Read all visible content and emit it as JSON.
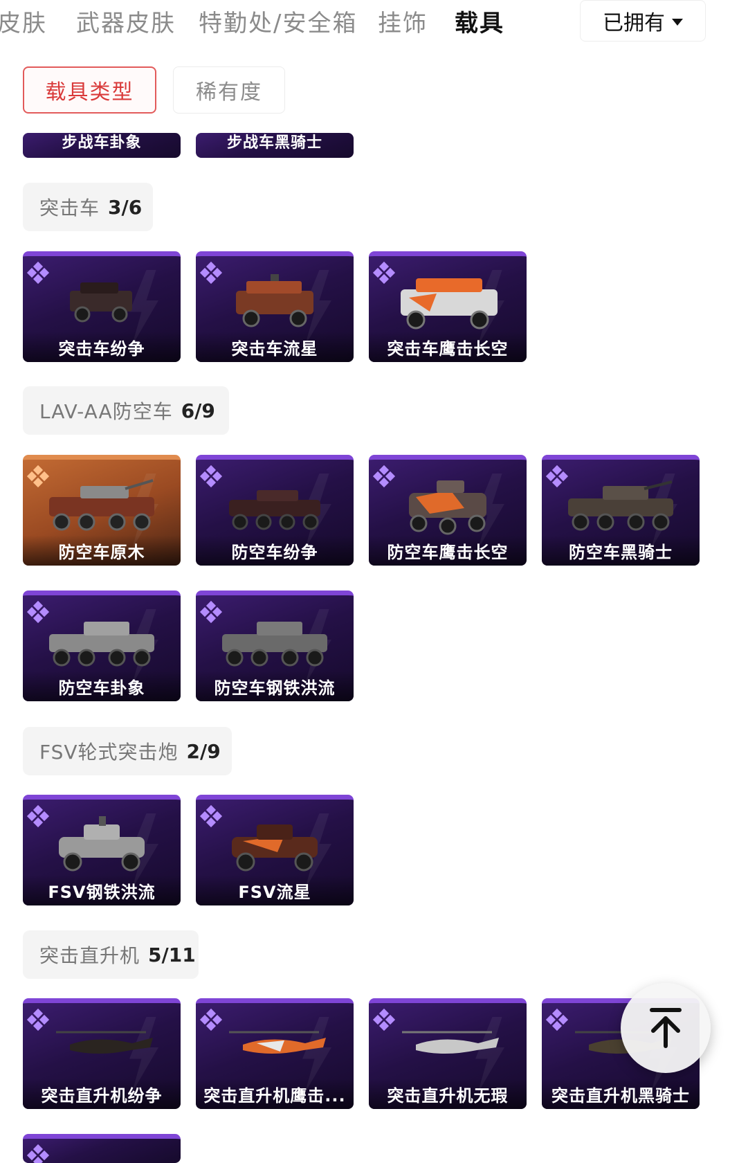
{
  "tabs": [
    {
      "label": "皮肤"
    },
    {
      "label": "武器皮肤"
    },
    {
      "label": "特勤处/安全箱"
    },
    {
      "label": "挂饰"
    },
    {
      "label": "载具"
    }
  ],
  "owned_filter": {
    "label": "已拥有"
  },
  "filter_chips": {
    "type": "载具类型",
    "rarity": "稀有度"
  },
  "sections": {
    "infantry": {
      "items": [
        {
          "name": "步战车卦象"
        },
        {
          "name": "步战车黑骑士"
        }
      ]
    },
    "assault_vehicle": {
      "title": "突击车",
      "count": "3/6",
      "items": [
        {
          "name": "突击车纷争"
        },
        {
          "name": "突击车流星"
        },
        {
          "name": "突击车鹰击长空"
        }
      ]
    },
    "aa_vehicle": {
      "title": "LAV-AA防空车",
      "count": "6/9",
      "items": [
        {
          "name": "防空车原木"
        },
        {
          "name": "防空车纷争"
        },
        {
          "name": "防空车鹰击长空"
        },
        {
          "name": "防空车黑骑士"
        },
        {
          "name": "防空车卦象"
        },
        {
          "name": "防空车钢铁洪流"
        }
      ]
    },
    "fsv": {
      "title": "FSV轮式突击炮",
      "count": "2/9",
      "items": [
        {
          "name": "FSV钢铁洪流"
        },
        {
          "name": "FSV流星"
        }
      ]
    },
    "helicopter": {
      "title": "突击直升机",
      "count": "5/11",
      "items": [
        {
          "name": "突击直升机纷争"
        },
        {
          "name": "突击直升机鹰击..."
        },
        {
          "name": "突击直升机无瑕"
        },
        {
          "name": "突击直升机黑骑士"
        }
      ]
    }
  },
  "colors": {
    "accent_red": "#d93a3a",
    "card_purple": "#241046",
    "card_top_purple": "#7f45d6",
    "card_orange": "#9a4a22"
  },
  "icons": {
    "back_to_top": "arrow-up-icon",
    "rarity": "diamond-icon",
    "dropdown": "caret-down-icon"
  }
}
